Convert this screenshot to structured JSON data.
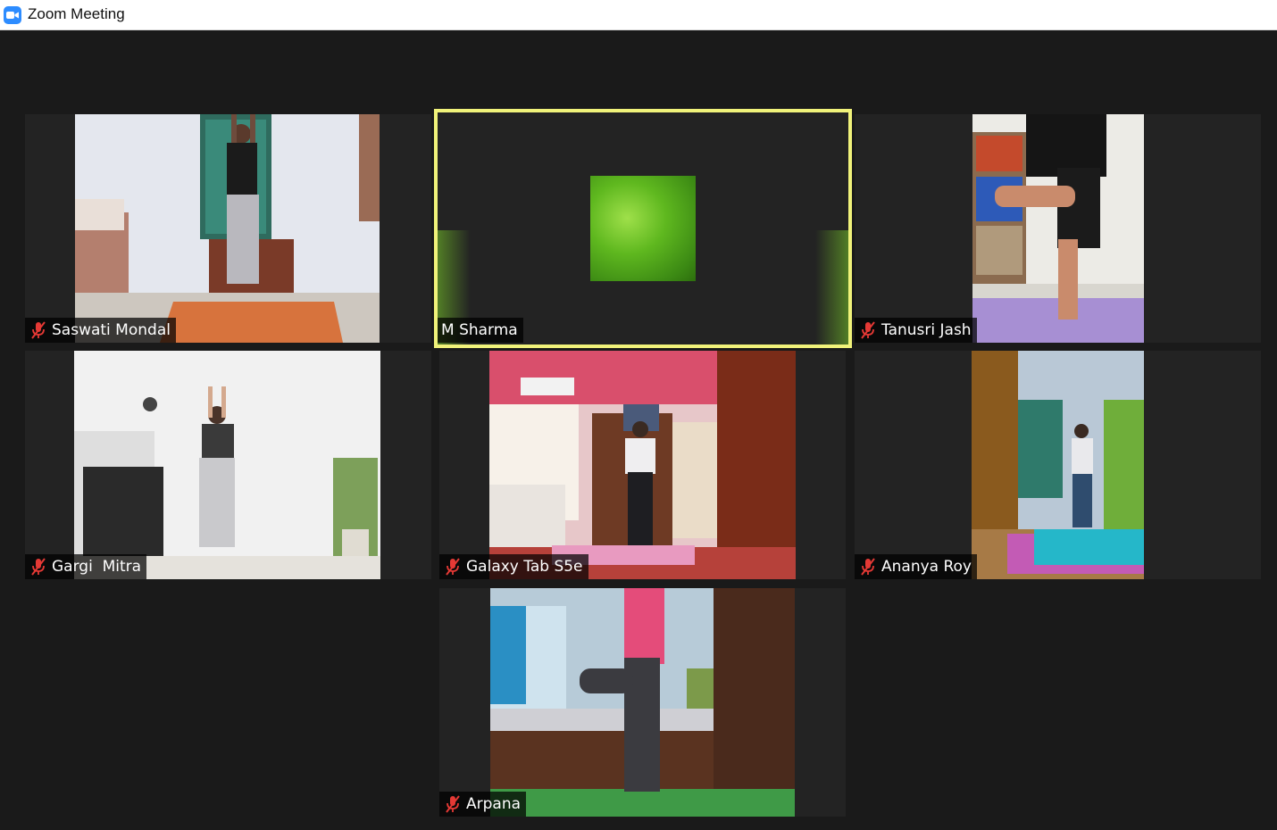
{
  "window": {
    "title": "Zoom Meeting",
    "app_icon": "zoom-camera-icon"
  },
  "participants": [
    {
      "name": "Saswati Mondal",
      "muted": true,
      "video": "room with orange yoga mat"
    },
    {
      "name": "M Sharma",
      "muted": false,
      "active_speaker": true,
      "video": "green thumbnail"
    },
    {
      "name": "Tanusri Jash",
      "muted": true,
      "video": "room with purple yoga mat"
    },
    {
      "name": "Gargi  Mitra",
      "muted": true,
      "video": "white room with plants"
    },
    {
      "name": "Galaxy Tab S5e",
      "muted": true,
      "video": "bedroom with pink mat"
    },
    {
      "name": "Ananya Roy",
      "muted": true,
      "video": "room with blue mat"
    },
    {
      "name": "Arpana",
      "muted": true,
      "video": "bedroom with green mat"
    }
  ],
  "colors": {
    "active_speaker_border": "#f0f27a",
    "muted_icon": "#e53935",
    "brand": "#2d8cff"
  }
}
